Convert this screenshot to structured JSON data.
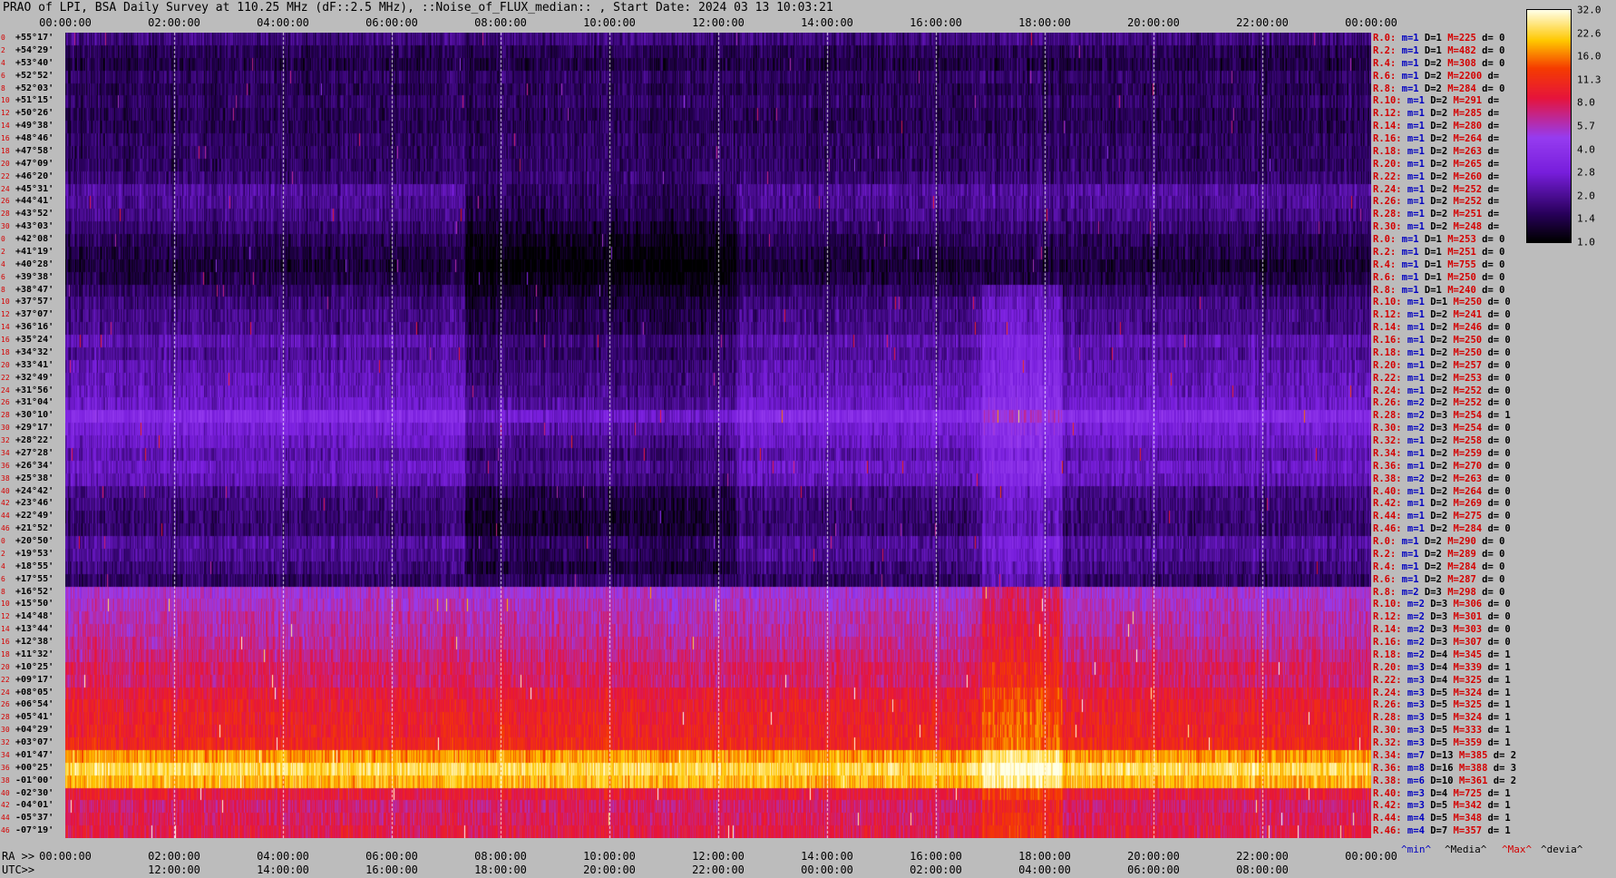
{
  "title": "PRAO of LPI, BSA Daily Survey at 110.25 MHz (dF::2.5 MHz), ::Noise_of_FLUX_median:: , Start Date: 2024 03 13 10:03:21",
  "top_ticks": [
    "00:00:00",
    "02:00:00",
    "04:00:00",
    "06:00:00",
    "08:00:00",
    "10:00:00",
    "12:00:00",
    "14:00:00",
    "16:00:00",
    "18:00:00",
    "20:00:00",
    "22:00:00",
    "00:00:00"
  ],
  "ra_label": "RA >>",
  "utc_label": "UTC>>",
  "bottom_ra_ticks": [
    "00:00:00",
    "02:00:00",
    "04:00:00",
    "06:00:00",
    "08:00:00",
    "10:00:00",
    "12:00:00",
    "14:00:00",
    "16:00:00",
    "18:00:00",
    "20:00:00",
    "22:00:00",
    "00:00:00"
  ],
  "bottom_utc_ticks": [
    "12:00:00",
    "14:00:00",
    "16:00:00",
    "18:00:00",
    "20:00:00",
    "22:00:00",
    "00:00:00",
    "02:00:00",
    "04:00:00",
    "06:00:00",
    "08:00:00"
  ],
  "stat_footer": {
    "min": "^min^",
    "median": "^Media^",
    "max": "^Max^",
    "dev": "^devia^"
  },
  "colors": {
    "background": "#bcbcbc",
    "label_red": "#d40000",
    "label_blue": "#0000c0"
  },
  "chart_data": {
    "type": "heatmap",
    "colormap": "black-purple-red-yellow-white",
    "colorbar_ticks": [
      "32.0",
      "22.6",
      "16.0",
      "11.3",
      "8.0",
      "5.7",
      "4.0",
      "2.8",
      "2.0",
      "1.4",
      "1.0"
    ],
    "colorbar_range": [
      1.0,
      32.0
    ],
    "x_range_ra_hours": [
      0,
      24
    ],
    "declinations": [
      "+55°17'",
      "+54°29'",
      "+53°40'",
      "+52°52'",
      "+52°03'",
      "+51°15'",
      "+50°26'",
      "+49°38'",
      "+48°46'",
      "+47°58'",
      "+47°09'",
      "+46°20'",
      "+45°31'",
      "+44°41'",
      "+43°52'",
      "+43°03'",
      "+42°08'",
      "+41°19'",
      "+40°28'",
      "+39°38'",
      "+38°47'",
      "+37°57'",
      "+37°07'",
      "+36°16'",
      "+35°24'",
      "+34°32'",
      "+33°41'",
      "+32°49'",
      "+31°56'",
      "+31°04'",
      "+30°10'",
      "+29°17'",
      "+28°22'",
      "+27°28'",
      "+26°34'",
      "+25°38'",
      "+24°42'",
      "+23°46'",
      "+22°49'",
      "+21°52'",
      "+20°50'",
      "+19°53'",
      "+18°55'",
      "+17°55'",
      "+16°52'",
      "+15°50'",
      "+14°48'",
      "+13°44'",
      "+12°38'",
      "+11°32'",
      "+10°25'",
      "+09°17'",
      "+08°05'",
      "+06°54'",
      "+05°41'",
      "+04°29'",
      "+03°07'",
      "+01°47'",
      "+00°25'",
      "-01°00'",
      "-02°30'",
      "-04°01'",
      "-05°37'",
      "-07°19'"
    ],
    "row_indices": [
      "0",
      "2",
      "4",
      "6",
      "8",
      "10",
      "12",
      "14",
      "16",
      "18",
      "20",
      "22",
      "24",
      "26",
      "28",
      "30",
      "0",
      "2",
      "4",
      "6",
      "8",
      "10",
      "12",
      "14",
      "16",
      "18",
      "20",
      "22",
      "24",
      "26",
      "28",
      "30",
      "32",
      "34",
      "36",
      "38",
      "40",
      "42",
      "44",
      "46",
      "0",
      "2",
      "4",
      "6",
      "8",
      "10",
      "12",
      "14",
      "16",
      "18",
      "20",
      "22",
      "24",
      "26",
      "28",
      "30",
      "32",
      "34",
      "36",
      "38",
      "40",
      "42",
      "44",
      "46"
    ],
    "row_levels": [
      1.8,
      1.5,
      1.4,
      1.6,
      1.5,
      1.6,
      1.5,
      1.5,
      1.6,
      1.6,
      1.6,
      1.7,
      2.1,
      2.0,
      1.9,
      1.7,
      1.5,
      1.4,
      1.3,
      1.4,
      1.6,
      1.8,
      1.9,
      1.9,
      2.3,
      2.1,
      2.3,
      2.4,
      2.5,
      2.7,
      3.6,
      2.9,
      2.6,
      2.3,
      2.6,
      2.4,
      1.9,
      1.8,
      1.7,
      1.7,
      2.1,
      2.0,
      1.8,
      1.6,
      5.2,
      5.6,
      6.0,
      6.2,
      6.6,
      7.0,
      7.8,
      7.6,
      9.0,
      9.6,
      10.0,
      10.2,
      10.8,
      18.0,
      24.0,
      20.0,
      9.0,
      7.5,
      8.0,
      8.5
    ],
    "stats": [
      {
        "r": "R.0:",
        "m": "m=1",
        "d": "D=1",
        "M": "M=225",
        "dev": "d= 0"
      },
      {
        "r": "R.2:",
        "m": "m=1",
        "d": "D=1",
        "M": "M=482",
        "dev": "d= 0"
      },
      {
        "r": "R.4:",
        "m": "m=1",
        "d": "D=2",
        "M": "M=308",
        "dev": "d= 0"
      },
      {
        "r": "R.6:",
        "m": "m=1",
        "d": "D=2",
        "M": "M=2200",
        "dev": "d="
      },
      {
        "r": "R.8:",
        "m": "m=1",
        "d": "D=2",
        "M": "M=284",
        "dev": "d= 0"
      },
      {
        "r": "R.10:",
        "m": "m=1",
        "d": "D=2",
        "M": "M=291",
        "dev": "d="
      },
      {
        "r": "R.12:",
        "m": "m=1",
        "d": "D=2",
        "M": "M=285",
        "dev": "d="
      },
      {
        "r": "R.14:",
        "m": "m=1",
        "d": "D=2",
        "M": "M=280",
        "dev": "d="
      },
      {
        "r": "R.16:",
        "m": "m=1",
        "d": "D=2",
        "M": "M=264",
        "dev": "d="
      },
      {
        "r": "R.18:",
        "m": "m=1",
        "d": "D=2",
        "M": "M=263",
        "dev": "d="
      },
      {
        "r": "R.20:",
        "m": "m=1",
        "d": "D=2",
        "M": "M=265",
        "dev": "d="
      },
      {
        "r": "R.22:",
        "m": "m=1",
        "d": "D=2",
        "M": "M=260",
        "dev": "d="
      },
      {
        "r": "R.24:",
        "m": "m=1",
        "d": "D=2",
        "M": "M=252",
        "dev": "d="
      },
      {
        "r": "R.26:",
        "m": "m=1",
        "d": "D=2",
        "M": "M=252",
        "dev": "d="
      },
      {
        "r": "R.28:",
        "m": "m=1",
        "d": "D=2",
        "M": "M=251",
        "dev": "d="
      },
      {
        "r": "R.30:",
        "m": "m=1",
        "d": "D=2",
        "M": "M=248",
        "dev": "d="
      },
      {
        "r": "R.0:",
        "m": "m=1",
        "d": "D=1",
        "M": "M=253",
        "dev": "d= 0"
      },
      {
        "r": "R.2:",
        "m": "m=1",
        "d": "D=1",
        "M": "M=251",
        "dev": "d= 0"
      },
      {
        "r": "R.4:",
        "m": "m=1",
        "d": "D=1",
        "M": "M=755",
        "dev": "d= 0"
      },
      {
        "r": "R.6:",
        "m": "m=1",
        "d": "D=1",
        "M": "M=250",
        "dev": "d= 0"
      },
      {
        "r": "R.8:",
        "m": "m=1",
        "d": "D=1",
        "M": "M=240",
        "dev": "d= 0"
      },
      {
        "r": "R.10:",
        "m": "m=1",
        "d": "D=1",
        "M": "M=250",
        "dev": "d= 0"
      },
      {
        "r": "R.12:",
        "m": "m=1",
        "d": "D=2",
        "M": "M=241",
        "dev": "d= 0"
      },
      {
        "r": "R.14:",
        "m": "m=1",
        "d": "D=2",
        "M": "M=246",
        "dev": "d= 0"
      },
      {
        "r": "R.16:",
        "m": "m=1",
        "d": "D=2",
        "M": "M=250",
        "dev": "d= 0"
      },
      {
        "r": "R.18:",
        "m": "m=1",
        "d": "D=2",
        "M": "M=250",
        "dev": "d= 0"
      },
      {
        "r": "R.20:",
        "m": "m=1",
        "d": "D=2",
        "M": "M=257",
        "dev": "d= 0"
      },
      {
        "r": "R.22:",
        "m": "m=1",
        "d": "D=2",
        "M": "M=253",
        "dev": "d= 0"
      },
      {
        "r": "R.24:",
        "m": "m=1",
        "d": "D=2",
        "M": "M=252",
        "dev": "d= 0"
      },
      {
        "r": "R.26:",
        "m": "m=2",
        "d": "D=2",
        "M": "M=252",
        "dev": "d= 0"
      },
      {
        "r": "R.28:",
        "m": "m=2",
        "d": "D=3",
        "M": "M=254",
        "dev": "d= 1"
      },
      {
        "r": "R.30:",
        "m": "m=2",
        "d": "D=3",
        "M": "M=254",
        "dev": "d= 0"
      },
      {
        "r": "R.32:",
        "m": "m=1",
        "d": "D=2",
        "M": "M=258",
        "dev": "d= 0"
      },
      {
        "r": "R.34:",
        "m": "m=1",
        "d": "D=2",
        "M": "M=259",
        "dev": "d= 0"
      },
      {
        "r": "R.36:",
        "m": "m=1",
        "d": "D=2",
        "M": "M=270",
        "dev": "d= 0"
      },
      {
        "r": "R.38:",
        "m": "m=2",
        "d": "D=2",
        "M": "M=263",
        "dev": "d= 0"
      },
      {
        "r": "R.40:",
        "m": "m=1",
        "d": "D=2",
        "M": "M=264",
        "dev": "d= 0"
      },
      {
        "r": "R.42:",
        "m": "m=1",
        "d": "D=2",
        "M": "M=269",
        "dev": "d= 0"
      },
      {
        "r": "R.44:",
        "m": "m=1",
        "d": "D=2",
        "M": "M=275",
        "dev": "d= 0"
      },
      {
        "r": "R.46:",
        "m": "m=1",
        "d": "D=2",
        "M": "M=284",
        "dev": "d= 0"
      },
      {
        "r": "R.0:",
        "m": "m=1",
        "d": "D=2",
        "M": "M=290",
        "dev": "d= 0"
      },
      {
        "r": "R.2:",
        "m": "m=1",
        "d": "D=2",
        "M": "M=289",
        "dev": "d= 0"
      },
      {
        "r": "R.4:",
        "m": "m=1",
        "d": "D=2",
        "M": "M=284",
        "dev": "d= 0"
      },
      {
        "r": "R.6:",
        "m": "m=1",
        "d": "D=2",
        "M": "M=287",
        "dev": "d= 0"
      },
      {
        "r": "R.8:",
        "m": "m=2",
        "d": "D=3",
        "M": "M=298",
        "dev": "d= 0"
      },
      {
        "r": "R.10:",
        "m": "m=2",
        "d": "D=3",
        "M": "M=306",
        "dev": "d= 0"
      },
      {
        "r": "R.12:",
        "m": "m=2",
        "d": "D=3",
        "M": "M=301",
        "dev": "d= 0"
      },
      {
        "r": "R.14:",
        "m": "m=2",
        "d": "D=3",
        "M": "M=303",
        "dev": "d= 0"
      },
      {
        "r": "R.16:",
        "m": "m=2",
        "d": "D=3",
        "M": "M=307",
        "dev": "d= 0"
      },
      {
        "r": "R.18:",
        "m": "m=2",
        "d": "D=4",
        "M": "M=345",
        "dev": "d= 1"
      },
      {
        "r": "R.20:",
        "m": "m=3",
        "d": "D=4",
        "M": "M=339",
        "dev": "d= 1"
      },
      {
        "r": "R.22:",
        "m": "m=3",
        "d": "D=4",
        "M": "M=325",
        "dev": "d= 1"
      },
      {
        "r": "R.24:",
        "m": "m=3",
        "d": "D=5",
        "M": "M=324",
        "dev": "d= 1"
      },
      {
        "r": "R.26:",
        "m": "m=3",
        "d": "D=5",
        "M": "M=325",
        "dev": "d= 1"
      },
      {
        "r": "R.28:",
        "m": "m=3",
        "d": "D=5",
        "M": "M=324",
        "dev": "d= 1"
      },
      {
        "r": "R.30:",
        "m": "m=3",
        "d": "D=5",
        "M": "M=333",
        "dev": "d= 1"
      },
      {
        "r": "R.32:",
        "m": "m=3",
        "d": "D=5",
        "M": "M=359",
        "dev": "d= 1"
      },
      {
        "r": "R.34:",
        "m": "m=7",
        "d": "D=13",
        "M": "M=385",
        "dev": "d= 2"
      },
      {
        "r": "R.36:",
        "m": "m=8",
        "d": "D=16",
        "M": "M=388",
        "dev": "d= 3"
      },
      {
        "r": "R.38:",
        "m": "m=6",
        "d": "D=10",
        "M": "M=361",
        "dev": "d= 2"
      },
      {
        "r": "R.40:",
        "m": "m=3",
        "d": "D=4",
        "M": "M=725",
        "dev": "d= 1"
      },
      {
        "r": "R.42:",
        "m": "m=3",
        "d": "D=5",
        "M": "M=342",
        "dev": "d= 1"
      },
      {
        "r": "R.44:",
        "m": "m=4",
        "d": "D=5",
        "M": "M=348",
        "dev": "d= 1"
      },
      {
        "r": "R.46:",
        "m": "m=4",
        "d": "D=7",
        "M": "M=357",
        "dev": "d= 1"
      }
    ]
  }
}
